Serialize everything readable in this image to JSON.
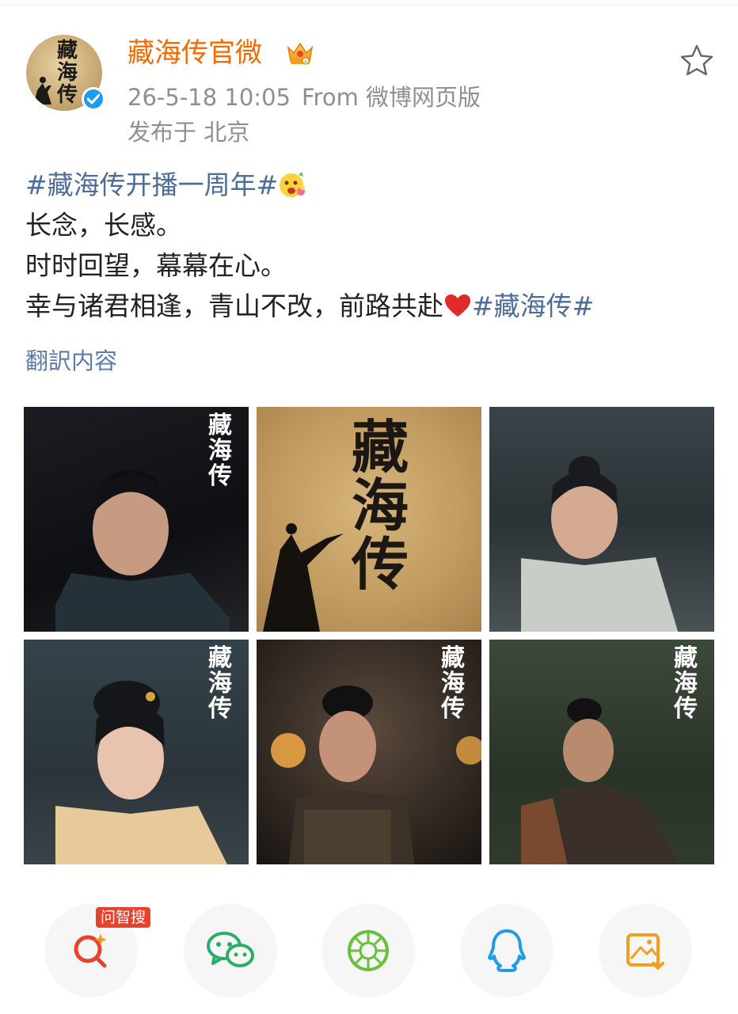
{
  "post": {
    "username": "藏海传官微",
    "avatar_text": "藏海传",
    "date": "26-5-18 10:05",
    "source": "From 微博网页版",
    "location": "发布于 北京",
    "hashtag_main": "#藏海传开播一周年#",
    "line1": "长念，长感。",
    "line2": "时时回望，幕幕在心。",
    "line3_text": "幸与诸君相逢，青山不改，前路共赴",
    "line3_tag": "#藏海传#",
    "translate_label": "翻訳内容"
  },
  "photos": {
    "logo_text": "藏海传",
    "big_logo_text": "藏海传",
    "count": 6
  },
  "share": {
    "badge": "问智搜",
    "items": [
      "search-ai-icon",
      "wechat-icon",
      "moments-icon",
      "qq-icon",
      "save-image-icon"
    ]
  },
  "colors": {
    "username": "#f56a00",
    "hashtag": "#4c6c9a",
    "meta": "#8f8f8f",
    "verified": "#1d9bf0",
    "badge": "#e8412e"
  }
}
